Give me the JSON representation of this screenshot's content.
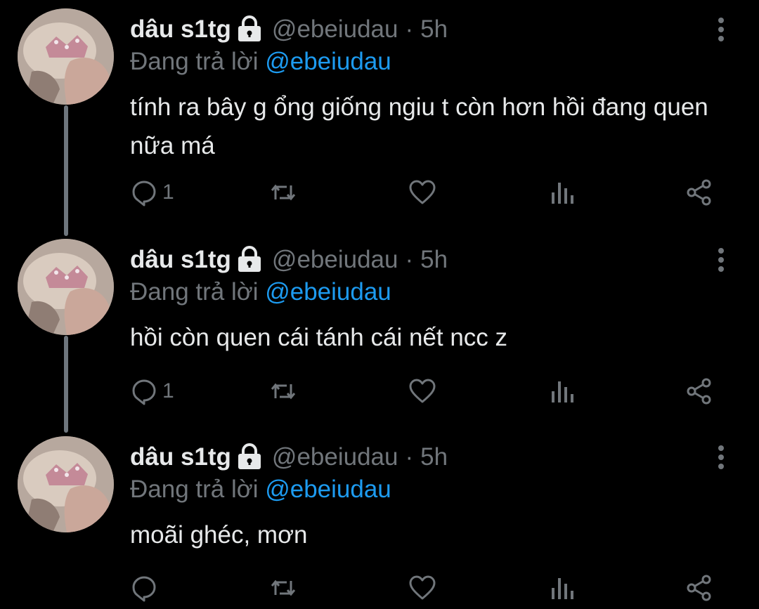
{
  "thread": {
    "tweets": [
      {
        "display_name": "dâu s1tg",
        "handle": "@ebeiudau",
        "separator": "·",
        "time": "5h",
        "reply_prefix": "Đang trả lời",
        "reply_to": "@ebeiudau",
        "text": "tính ra bây g ổng giống ngiu t còn hơn hồi đang quen nữa má",
        "reply_count": "1",
        "retweet_count": "",
        "like_count": "",
        "view_count": ""
      },
      {
        "display_name": "dâu s1tg",
        "handle": "@ebeiudau",
        "separator": "·",
        "time": "5h",
        "reply_prefix": "Đang trả lời",
        "reply_to": "@ebeiudau",
        "text": "hồi còn quen cái tánh cái nết ncc z",
        "reply_count": "1",
        "retweet_count": "",
        "like_count": "",
        "view_count": ""
      },
      {
        "display_name": "dâu s1tg",
        "handle": "@ebeiudau",
        "separator": "·",
        "time": "5h",
        "reply_prefix": "Đang trả lời",
        "reply_to": "@ebeiudau",
        "text": "moãi ghéc, mơn",
        "reply_count": "",
        "retweet_count": "",
        "like_count": "",
        "view_count": ""
      }
    ]
  },
  "icons": {
    "protected": "lock-icon",
    "more": "more-vertical-icon",
    "reply": "reply-icon",
    "retweet": "retweet-icon",
    "like": "heart-icon",
    "views": "views-icon",
    "share": "share-icon"
  },
  "colors": {
    "background": "#000000",
    "primary_text": "#e7e9ea",
    "secondary_text": "#71767b",
    "mention": "#1d9bf0",
    "thread_line": "#6e767d"
  }
}
